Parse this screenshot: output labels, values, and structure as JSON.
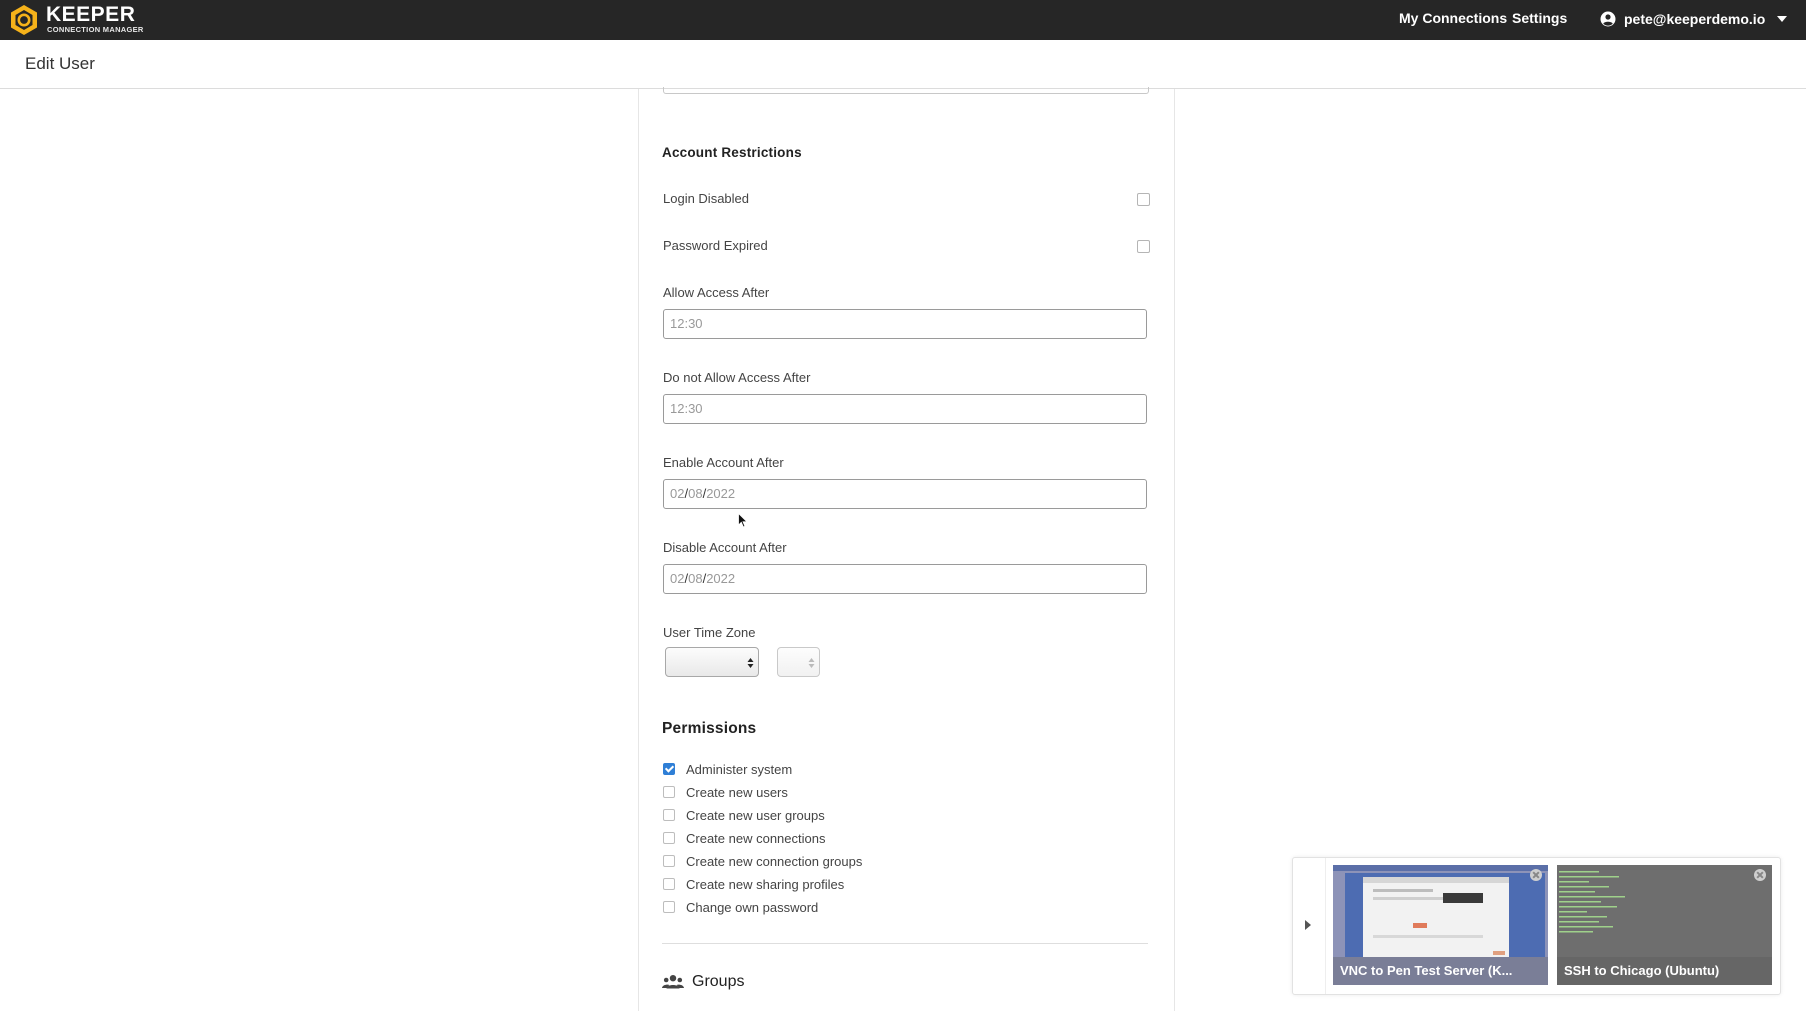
{
  "topbar": {
    "brand": "KEEPER",
    "brand_sub": "CONNECTION MANAGER",
    "nav": [
      "My Connections",
      "Settings"
    ],
    "user_email": "pete@keeperdemo.io"
  },
  "page": {
    "title": "Edit User"
  },
  "account_restrictions": {
    "heading": "Account Restrictions",
    "login_disabled": {
      "label": "Login Disabled",
      "checked": false
    },
    "password_expired": {
      "label": "Password Expired",
      "checked": false
    },
    "allow_access_after": {
      "label": "Allow Access After",
      "value": "12:30"
    },
    "deny_access_after": {
      "label": "Do not Allow Access After",
      "value": "12:30"
    },
    "enable_account_after": {
      "label": "Enable Account After",
      "month": "02",
      "day": "08",
      "year": "2022"
    },
    "disable_account_after": {
      "label": "Disable Account After",
      "month": "02",
      "day": "08",
      "year": "2022"
    },
    "time_zone": {
      "label": "User Time Zone",
      "region": "",
      "zone": ""
    }
  },
  "permissions": {
    "heading": "Permissions",
    "items": [
      {
        "label": "Administer system",
        "checked": true
      },
      {
        "label": "Create new users",
        "checked": false
      },
      {
        "label": "Create new user groups",
        "checked": false
      },
      {
        "label": "Create new connections",
        "checked": false
      },
      {
        "label": "Create new connection groups",
        "checked": false
      },
      {
        "label": "Create new sharing profiles",
        "checked": false
      },
      {
        "label": "Change own password",
        "checked": false
      }
    ]
  },
  "groups": {
    "heading": "Groups"
  },
  "active_connections": [
    {
      "caption": "VNC to Pen Test Server (K...",
      "kind": "vnc"
    },
    {
      "caption": "SSH to Chicago (Ubuntu)",
      "kind": "ssh"
    }
  ],
  "colors": {
    "topbar": "#262626",
    "brand_yellow": "#f5b21a",
    "checkbox_checked": "#2f7fd6"
  }
}
